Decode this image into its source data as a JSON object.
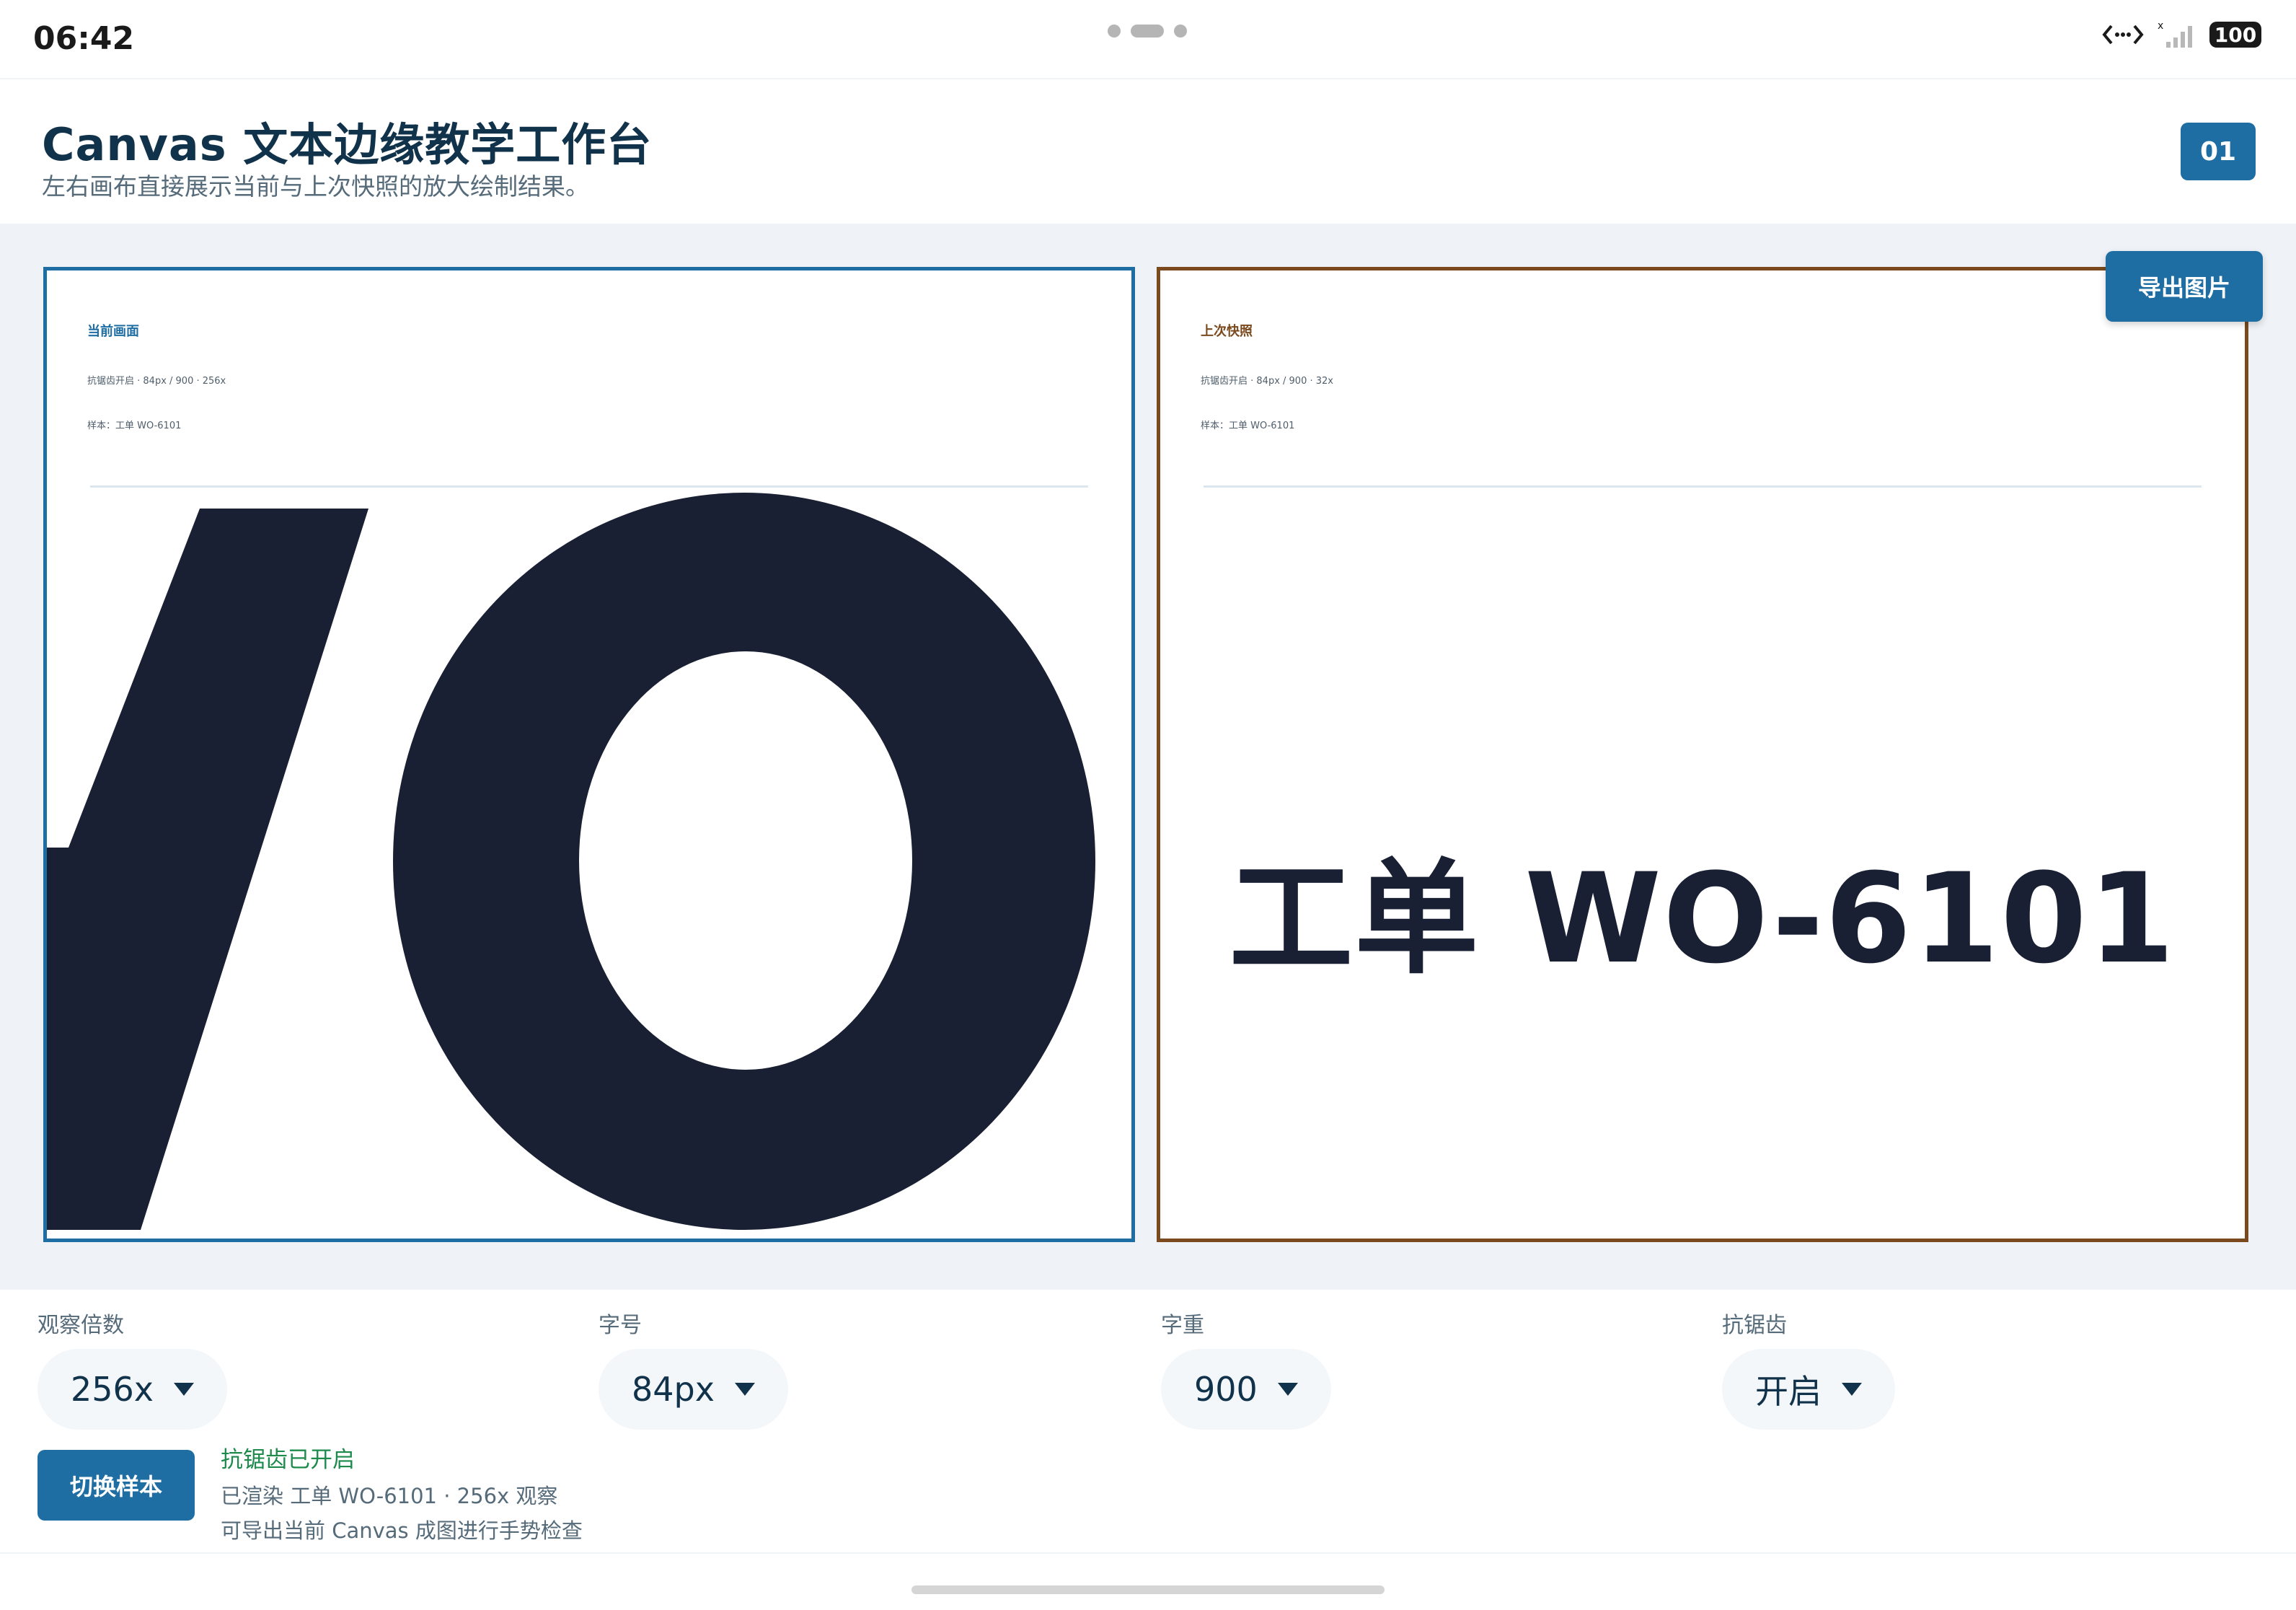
{
  "status_bar": {
    "time": "06:42",
    "battery": "100",
    "icons": [
      "dev-proxy-icon",
      "signal-icon",
      "battery-icon"
    ]
  },
  "header": {
    "title": "Canvas 文本边缘教学工作台",
    "subtitle": "左右画布直接展示当前与上次快照的放大绘制结果。",
    "badge": "01"
  },
  "panels": {
    "current": {
      "title": "当前画面",
      "meta": "抗锯齿开启 · 84px / 900 · 256x",
      "sample": "样本：工单 WO-6101"
    },
    "previous": {
      "title": "上次快照",
      "meta": "抗锯齿开启 · 84px / 900 · 32x",
      "sample": "样本：工单 WO-6101",
      "rendered_text": "工单 WO-6101"
    }
  },
  "export_button": "导出图片",
  "controls": {
    "zoom": {
      "label": "观察倍数",
      "value": "256x"
    },
    "font_size": {
      "label": "字号",
      "value": "84px"
    },
    "font_weight": {
      "label": "字重",
      "value": "900"
    },
    "antialias": {
      "label": "抗锯齿",
      "value": "开启"
    }
  },
  "switch_button": "切换样本",
  "status": {
    "ok": "抗锯齿已开启",
    "line1": "已渲染 工单 WO-6101 · 256x 观察",
    "line2": "可导出当前 Canvas 成图进行手势检查"
  },
  "colors": {
    "primary": "#1f6ea3",
    "snapshot_border": "#7a4a1e",
    "ink": "#1a2033",
    "success": "#1e8a4c"
  }
}
